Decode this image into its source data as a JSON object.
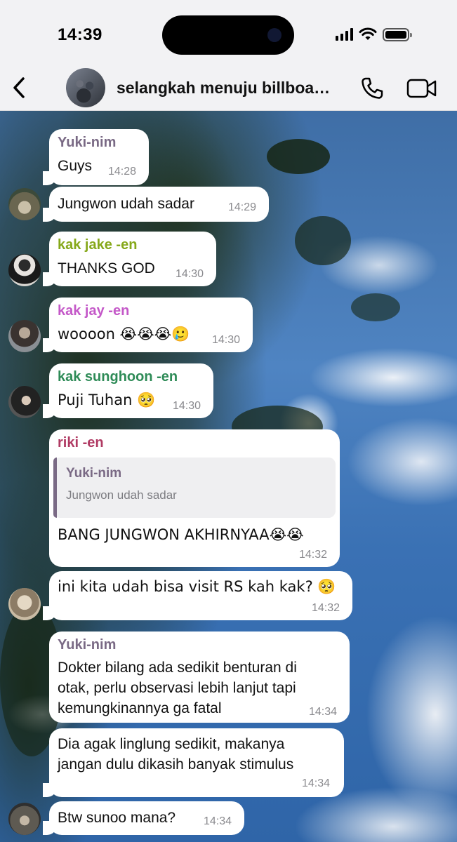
{
  "status_bar": {
    "time": "14:39"
  },
  "header": {
    "title": "selangkah menuju billboa…"
  },
  "colors": {
    "yuki": "#7a6a85",
    "jake": "#86a81a",
    "jay": "#c458c8",
    "sunghoon": "#2e8b57",
    "riki": "#b03a63"
  },
  "messages": [
    {
      "sender": "Yuki-nim",
      "text": "Guys",
      "time": "14:28"
    },
    {
      "text": "Jungwon udah sadar",
      "time": "14:29"
    },
    {
      "sender": "kak jake -en",
      "text": "THANKS GOD",
      "time": "14:30"
    },
    {
      "sender": "kak jay -en",
      "text": "woooon 😭😭😭🥲",
      "time": "14:30"
    },
    {
      "sender": "kak sunghoon -en",
      "text": "Puji Tuhan 🥺",
      "time": "14:30"
    },
    {
      "sender": "riki -en",
      "reply_to": {
        "sender": "Yuki-nim",
        "text": "Jungwon udah sadar"
      },
      "text": "BANG JUNGWON AKHIRNYAA😭😭",
      "time": "14:32"
    },
    {
      "text": "ini kita udah bisa visit RS kah kak? 🥺",
      "time": "14:32"
    },
    {
      "sender": "Yuki-nim",
      "lines": [
        "Dokter bilang ada sedikit benturan di",
        "otak, perlu observasi lebih lanjut tapi",
        "kemungkinannya ga fatal"
      ],
      "time": "14:34"
    },
    {
      "lines": [
        "Dia agak linglung sedikit, makanya",
        "jangan dulu dikasih banyak stimulus"
      ],
      "time": "14:34"
    },
    {
      "text": "Btw sunoo mana?",
      "time": "14:34"
    }
  ]
}
